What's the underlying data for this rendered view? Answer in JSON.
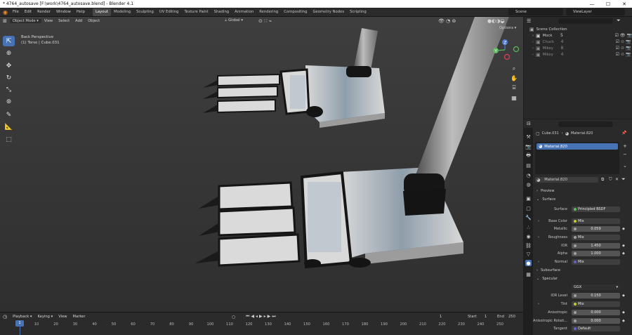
{
  "window": {
    "title": "* 4764_autosave [F:\\work\\4764_autosave.blend] - Blender 4.1",
    "minimize": "—",
    "maximize": "☐",
    "close": "✕"
  },
  "menu": [
    "File",
    "Edit",
    "Render",
    "Window",
    "Help"
  ],
  "workspaces": [
    "Layout",
    "Modeling",
    "Sculpting",
    "UV Editing",
    "Texture Paint",
    "Shading",
    "Animation",
    "Rendering",
    "Compositing",
    "Geometry Nodes",
    "Scripting"
  ],
  "scene": "Scene",
  "view_layer": "ViewLayer",
  "viewport": {
    "mode": "Object Mode",
    "menus": [
      "View",
      "Select",
      "Add",
      "Object"
    ],
    "orientation": "Global",
    "options": "Options",
    "view_name": "Back Perspective",
    "object_info": "(1) Torso | Cube.031",
    "gizmo": {
      "z": "Z",
      "y": "Y"
    }
  },
  "outliner": {
    "search_placeholder": "",
    "root": "Scene Collection",
    "items": [
      {
        "name": "Mock",
        "count": "5",
        "color": "#ffffff"
      },
      {
        "name": "Chuck",
        "count": "4",
        "color": "#9a9a9a"
      },
      {
        "name": "Mikey",
        "count": "8",
        "color": "#9a9a9a"
      },
      {
        "name": "Mikey",
        "count": "4",
        "color": "#9a9a9a"
      }
    ]
  },
  "properties": {
    "breadcrumb_object": "Cube.031",
    "breadcrumb_material": "Material.820",
    "slot": "Material.820",
    "material": "Material.820",
    "panels": {
      "preview": "Preview",
      "surface": "Surface",
      "subsurface": "Subsurface",
      "specular": "Specular"
    },
    "rows": {
      "surface": {
        "label": "Surface",
        "value": "Principled BSDF"
      },
      "base_color": {
        "label": "Base Color",
        "value": "Mix"
      },
      "metallic": {
        "label": "Metallic",
        "value": "0.059"
      },
      "roughness": {
        "label": "Roughness",
        "value": "Mix"
      },
      "ior": {
        "label": "IOR",
        "value": "1.450"
      },
      "alpha": {
        "label": "Alpha",
        "value": "1.000"
      },
      "normal": {
        "label": "Normal",
        "value": "Mix"
      },
      "distribution": {
        "label": "",
        "value": "GGX"
      },
      "ior_level": {
        "label": "IOR Level",
        "value": "0.150"
      },
      "tint": {
        "label": "Tint",
        "value": "Mix"
      },
      "anisotropic": {
        "label": "Anisotropic",
        "value": "0.000"
      },
      "aniso_rot": {
        "label": "Anisotropic Rotati...",
        "value": "0.000"
      },
      "tangent": {
        "label": "Tangent",
        "value": "Default"
      }
    }
  },
  "timeline": {
    "menus": [
      "Playback",
      "Keying",
      "View",
      "Marker"
    ],
    "current_frame": "1",
    "start_label": "Start",
    "start": "1",
    "end_label": "End",
    "end": "250",
    "ticks": [
      "1",
      "10",
      "20",
      "30",
      "40",
      "50",
      "60",
      "70",
      "80",
      "90",
      "100",
      "110",
      "120",
      "130",
      "140",
      "150",
      "160",
      "170",
      "180",
      "190",
      "200",
      "210",
      "220",
      "230",
      "240",
      "250"
    ],
    "playhead": "1"
  },
  "colors": {
    "accent": "#4772b3",
    "selected_text": "#ffffff",
    "socket_yellow": "#c7c729",
    "socket_gray": "#a1a1a1",
    "socket_purple": "#6363c7",
    "x_axis": "#e04050",
    "y_axis": "#5cb85c",
    "z_axis": "#4f7ad8"
  }
}
